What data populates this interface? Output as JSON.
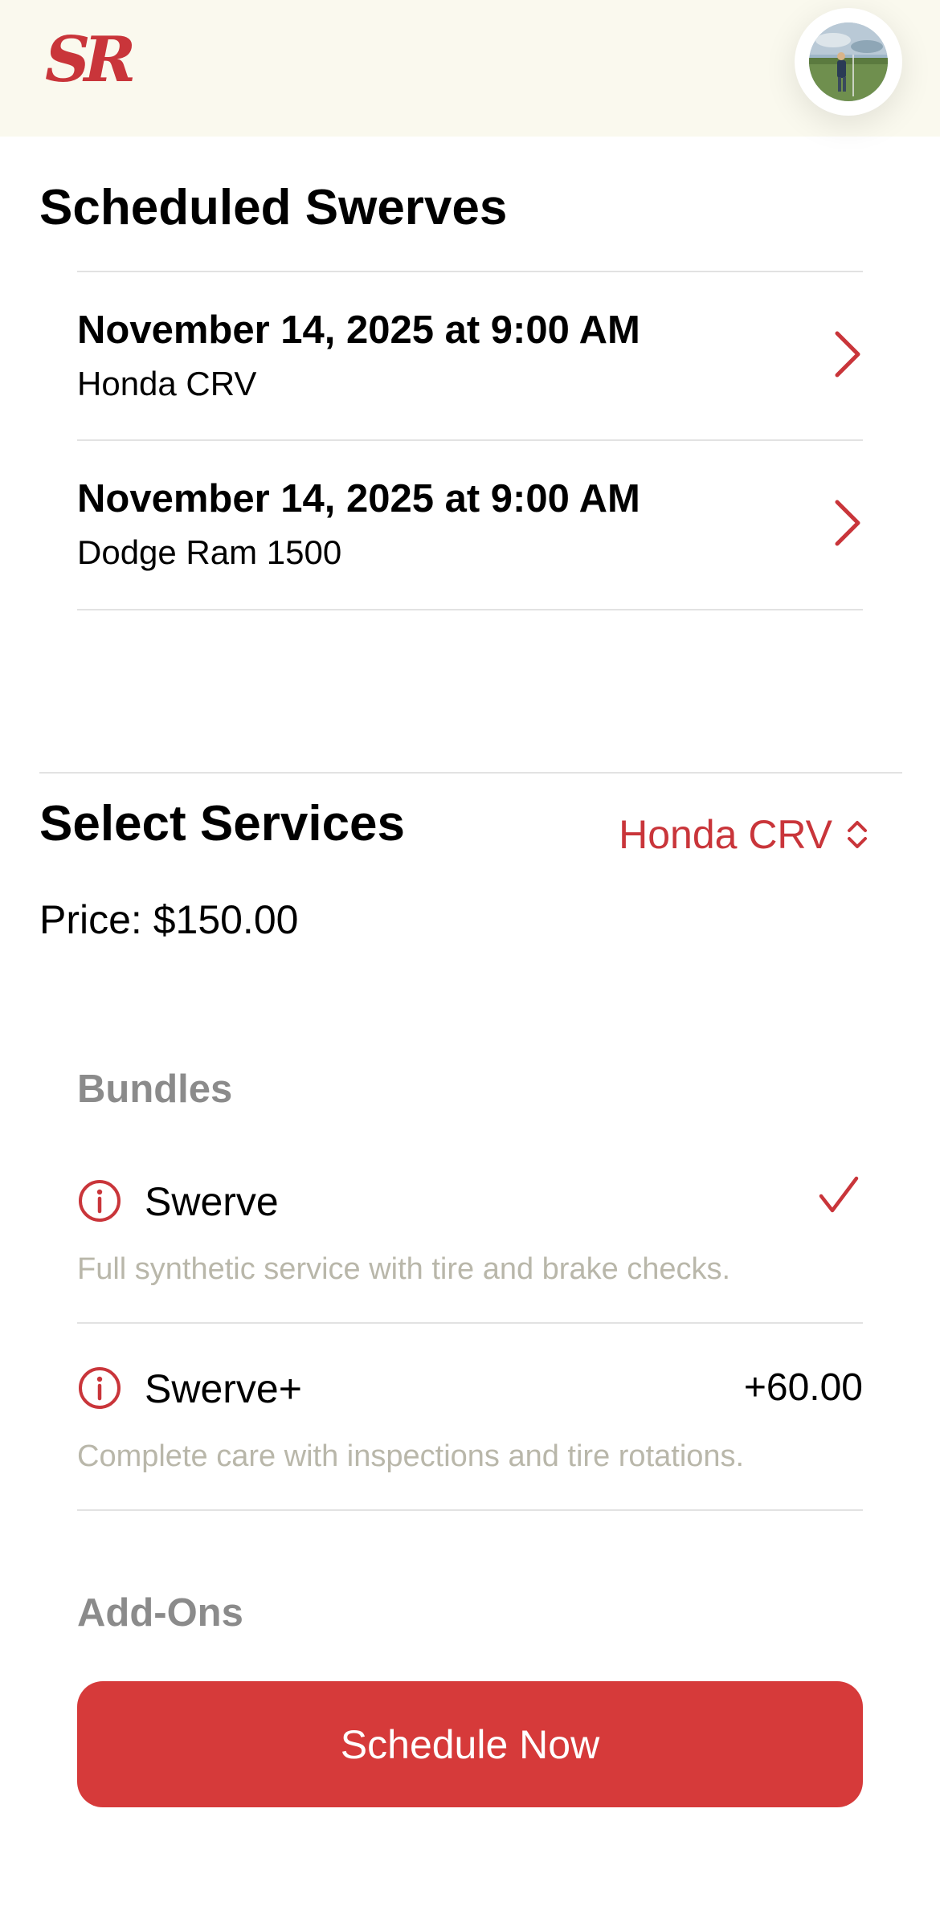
{
  "header": {
    "logo_text": "SR",
    "avatar_alt": "profile-photo"
  },
  "scheduled": {
    "title": "Scheduled Swerves",
    "items": [
      {
        "date": "November 14, 2025 at 9:00 AM",
        "vehicle": "Honda CRV"
      },
      {
        "date": "November 14, 2025 at 9:00 AM",
        "vehicle": "Dodge Ram 1500"
      }
    ]
  },
  "services": {
    "title": "Select Services",
    "vehicle_selected": "Honda CRV",
    "price_text": "Price: $150.00",
    "bundles_label": "Bundles",
    "bundles": [
      {
        "name": "Swerve",
        "description": "Full synthetic service with tire and brake checks.",
        "selected": true,
        "price_delta": ""
      },
      {
        "name": "Swerve+",
        "description": "Complete care with inspections and tire rotations.",
        "selected": false,
        "price_delta": "+60.00"
      }
    ],
    "addons_label": "Add-Ons",
    "cta_label": "Schedule Now"
  },
  "colors": {
    "accent": "#c9353a",
    "cta_background": "#d63a3a",
    "topbar_background": "#faf9ee",
    "muted_text": "#b9b7aa",
    "section_label": "#8b8b8b"
  },
  "icons": {
    "chevron": "chevron-right-icon",
    "updown": "chevron-up-down-icon",
    "info": "info-circle-icon",
    "check": "checkmark-icon"
  }
}
